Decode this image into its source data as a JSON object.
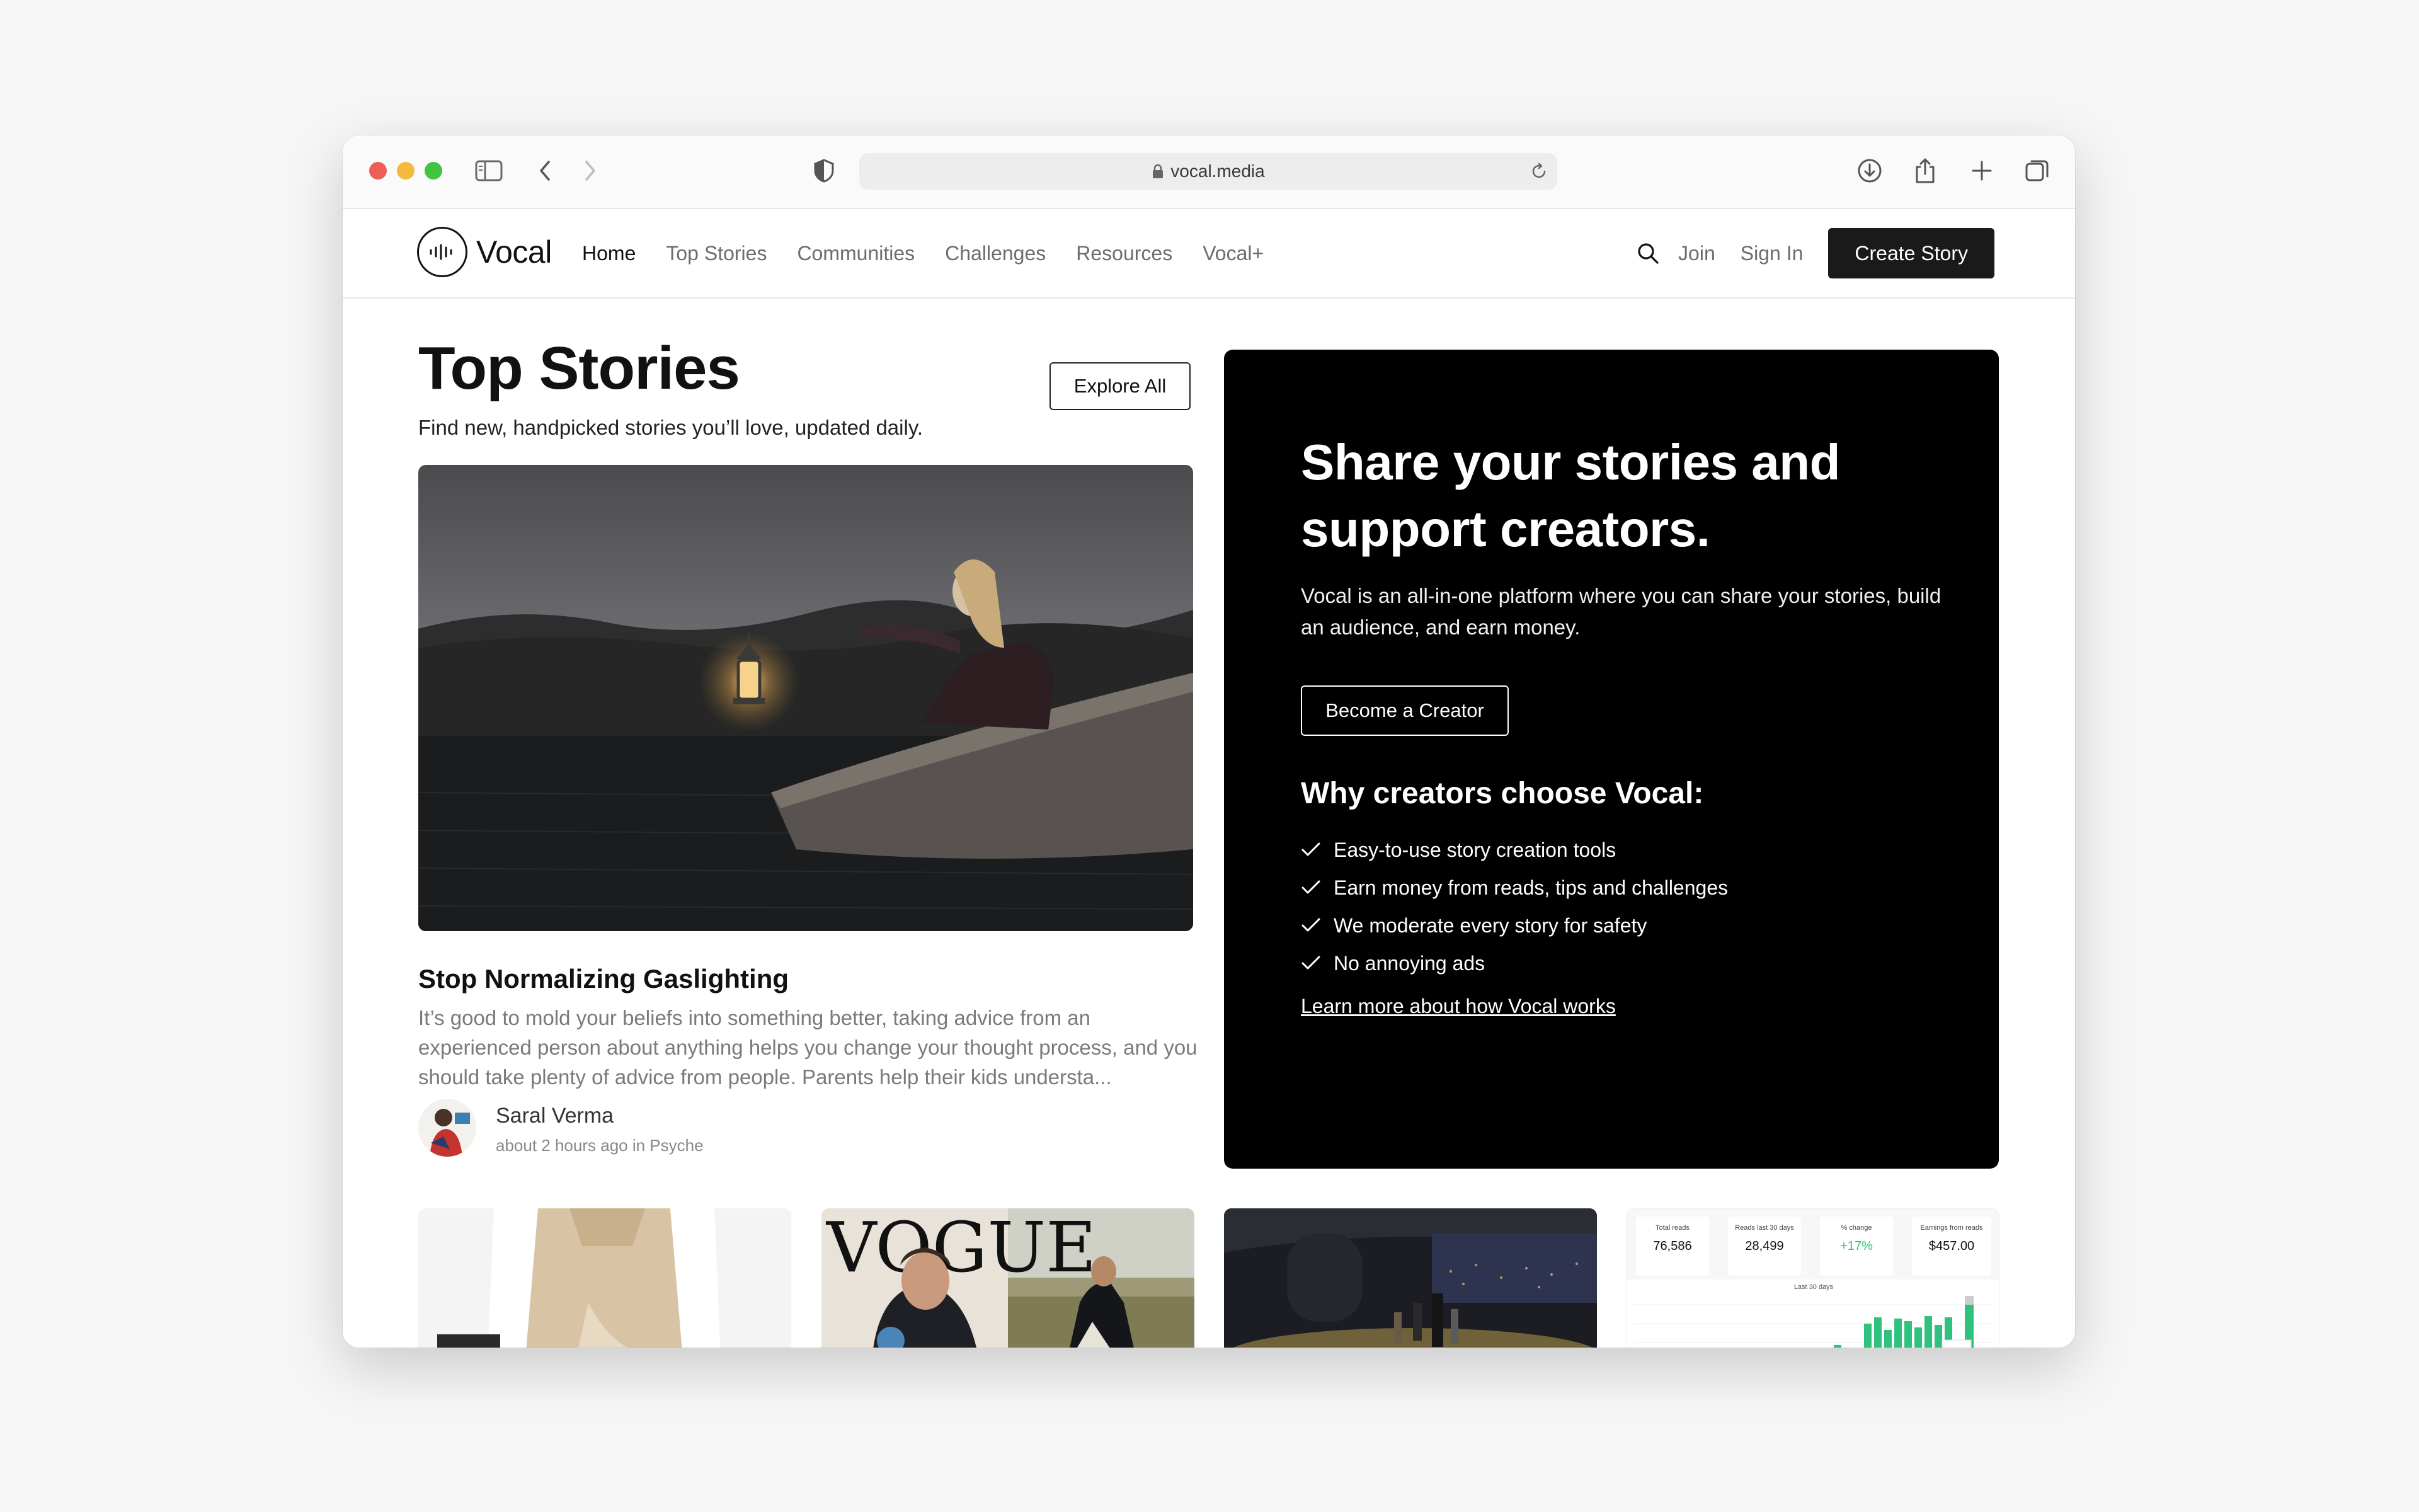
{
  "browser": {
    "url": "vocal.media"
  },
  "nav": {
    "logo": "Vocal",
    "items": [
      {
        "label": "Home",
        "active": true
      },
      {
        "label": "Top Stories",
        "active": false
      },
      {
        "label": "Communities",
        "active": false
      },
      {
        "label": "Challenges",
        "active": false
      },
      {
        "label": "Resources",
        "active": false
      },
      {
        "label": "Vocal+",
        "active": false
      }
    ],
    "join": "Join",
    "sign_in": "Sign In",
    "create_story": "Create Story"
  },
  "top_stories": {
    "title": "Top Stories",
    "subtitle": "Find new, handpicked stories you’ll love, updated daily.",
    "explore_all": "Explore All",
    "featured": {
      "title": "Stop Normalizing Gaslighting",
      "excerpt": "It’s good to mold your beliefs into something better, taking advice from an experienced person about anything helps you change your thought process, and you should take plenty of advice from people. Parents help their kids understa...",
      "author": "Saral Verma",
      "meta": "about 2 hours ago in Psyche"
    }
  },
  "promo": {
    "title": "Share your stories and support creators.",
    "text": "Vocal is an all-in-one platform where you can share your stories, build an audience, and earn money.",
    "cta": "Become a Creator",
    "why_title": "Why creators choose Vocal:",
    "reasons": [
      "Easy-to-use story creation tools",
      "Earn money from reads, tips and challenges",
      "We moderate every story for safety",
      "No annoying ads"
    ],
    "learn_more": "Learn more about how Vocal works"
  },
  "cards": {
    "vogue_wordmark": "VOGUE",
    "stats": {
      "labels": [
        "Total reads",
        "Reads last 30 days",
        "% change",
        "Earnings from reads"
      ],
      "values": [
        "76,586",
        "28,499",
        "+17%",
        "$457.00"
      ],
      "chart_label": "Last 30 days"
    }
  },
  "colors": {
    "primary_button": "#1a1a1a",
    "promo_bg": "#000000",
    "accent_green": "#2ec27e",
    "close": "#ee5e57",
    "minimize": "#f4b93f",
    "zoom": "#40c441"
  }
}
